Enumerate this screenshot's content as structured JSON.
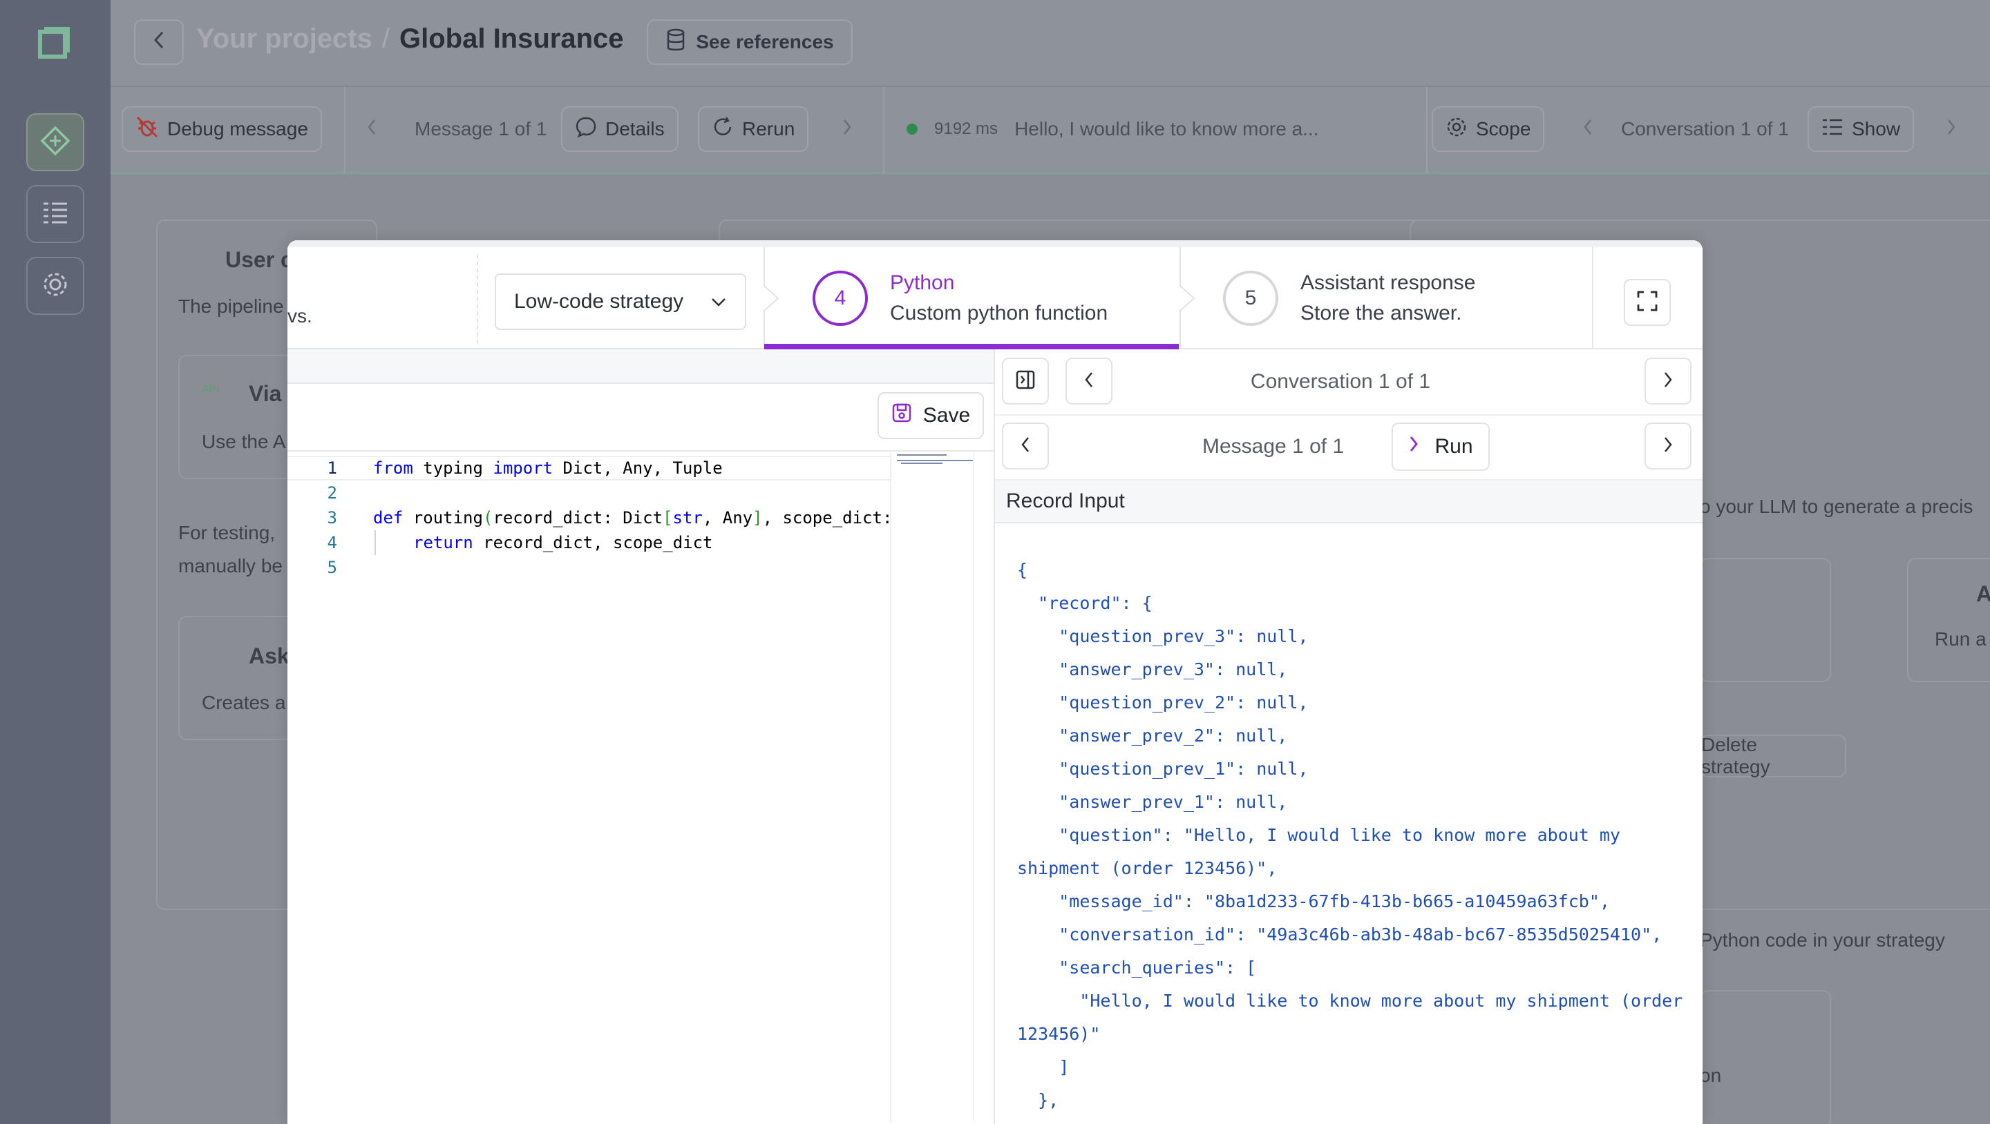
{
  "header": {
    "breadcrumb_parent": "Your projects",
    "breadcrumb_separator": "/",
    "breadcrumb_current": "Global Insurance",
    "see_references_label": "See references"
  },
  "toolbar": {
    "debug_label": "Debug message",
    "message_counter": "Message 1 of 1",
    "details_label": "Details",
    "rerun_label": "Rerun",
    "duration": "9192 ms",
    "message_preview": "Hello, I would like to know more a...",
    "scope_label": "Scope",
    "conversation_counter": "Conversation 1 of 1",
    "show_label": "Show"
  },
  "background": {
    "user_card_title": "User c",
    "pipeline_text": "The pipeline",
    "via_title": "Via",
    "api_badge": "API",
    "use_the_text": "Use the A",
    "for_testing_text": "For testing,",
    "manually_text": "manually be",
    "ask_title": "Ask",
    "creates_text": "Creates a",
    "llm_text": "o your LLM to generate a precis",
    "run_a_text": "Run a",
    "a_frag": "A",
    "delete_strategy_label": "Delete strategy",
    "python_code_text": "Python code in your strategy",
    "on_frag": "on"
  },
  "modal": {
    "steps": {
      "prev_fragment": "vs.",
      "strategy_select": "Low-code strategy",
      "step4_number": "4",
      "step4_title": "Python",
      "step4_subtitle": "Custom python function",
      "step5_number": "5",
      "step5_title": "Assistant response",
      "step5_subtitle": "Store the answer."
    },
    "editor": {
      "save_label": "Save",
      "line_numbers": [
        "1",
        "2",
        "3",
        "4",
        "5"
      ]
    },
    "right_panel": {
      "conversation_counter": "Conversation 1 of 1",
      "message_counter": "Message 1 of 1",
      "run_label": "Run",
      "record_input_title": "Record Input",
      "record_json": "{\n  \"record\": {\n    \"question_prev_3\": null,\n    \"answer_prev_3\": null,\n    \"question_prev_2\": null,\n    \"answer_prev_2\": null,\n    \"question_prev_1\": null,\n    \"answer_prev_1\": null,\n    \"question\": \"Hello, I would like to know more about my\nshipment (order 123456)\",\n    \"message_id\": \"8ba1d233-67fb-413b-b665-a10459a63fcb\",\n    \"conversation_id\": \"49a3c46b-ab3b-48ab-bc67-8535d5025410\",\n    \"search_queries\": [\n      \"Hello, I would like to know more about my shipment (order\n123456)\"\n    ]\n  },\n  \"results\": {"
    }
  },
  "colors": {
    "accent_purple": "#8c2bd1",
    "sidebar_bg": "#5f6574",
    "status_green": "#2f8a4c",
    "json_blue": "#1f4fb5"
  }
}
